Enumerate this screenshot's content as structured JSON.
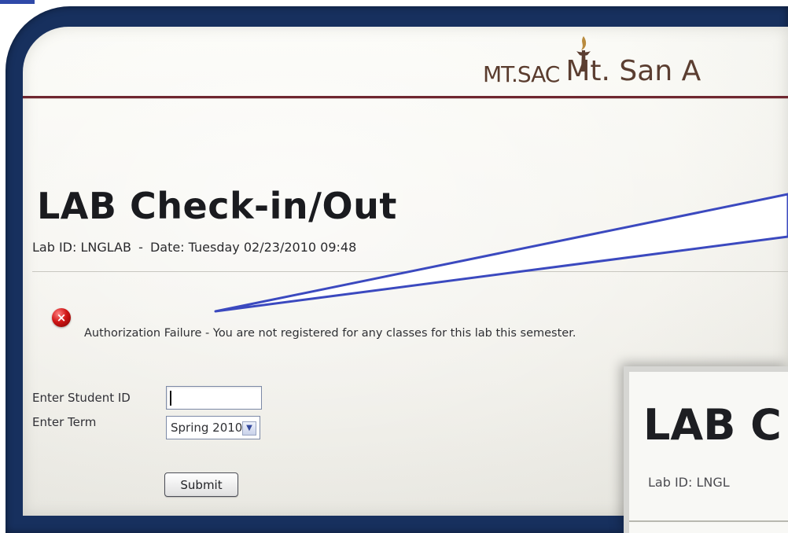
{
  "logo": {
    "mark_text": "MT.SAC",
    "name_text": "Mt. San A"
  },
  "page": {
    "title": "LAB Check-in/Out"
  },
  "lab_info": {
    "lab_id_label": "Lab ID:",
    "lab_id": "LNGLAB",
    "separator": "-",
    "date_label": "Date:",
    "date_value": "Tuesday 02/23/2010 09:48"
  },
  "alert": {
    "icon": "error-x-icon",
    "message": "Authorization Failure - You are not registered for any classes for this lab this semester."
  },
  "form": {
    "student_id_label": "Enter Student ID",
    "student_id_value": "",
    "term_label": "Enter Term",
    "term_selected": "Spring 2010",
    "submit_label": "Submit"
  },
  "zoom": {
    "title_fragment": "LAB C",
    "lab_fragment": "Lab ID: LNGL"
  },
  "colors": {
    "frame": "#17305e",
    "header_rule": "#6f2730",
    "callout_outline": "#3b49bf",
    "error_red": "#d01616"
  }
}
